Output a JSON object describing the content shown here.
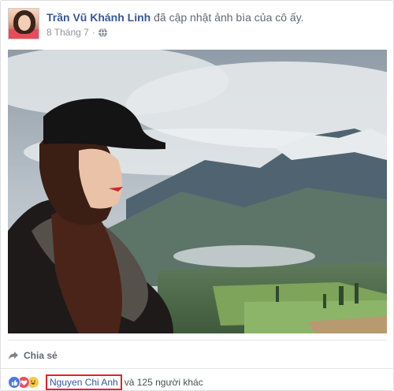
{
  "post": {
    "author": "Trần Vũ Khánh Linh",
    "action": " đã cập nhật ảnh bìa của cô ấy.",
    "date": "8 Tháng 7",
    "dot": "·",
    "privacy_icon": "globe-icon",
    "photo_description_icon": "cover-photo"
  },
  "actions": {
    "share_label": "Chia sẻ",
    "share_icon": "share-arrow-icon"
  },
  "reactions": {
    "icons": [
      "like-icon",
      "love-icon",
      "haha-icon"
    ],
    "liker_name": "Nguyen Chi Anh",
    "others_text": "và 125 người khác"
  },
  "colors": {
    "link": "#365899",
    "muted": "#90949c",
    "highlight_box": "#e2222a"
  }
}
